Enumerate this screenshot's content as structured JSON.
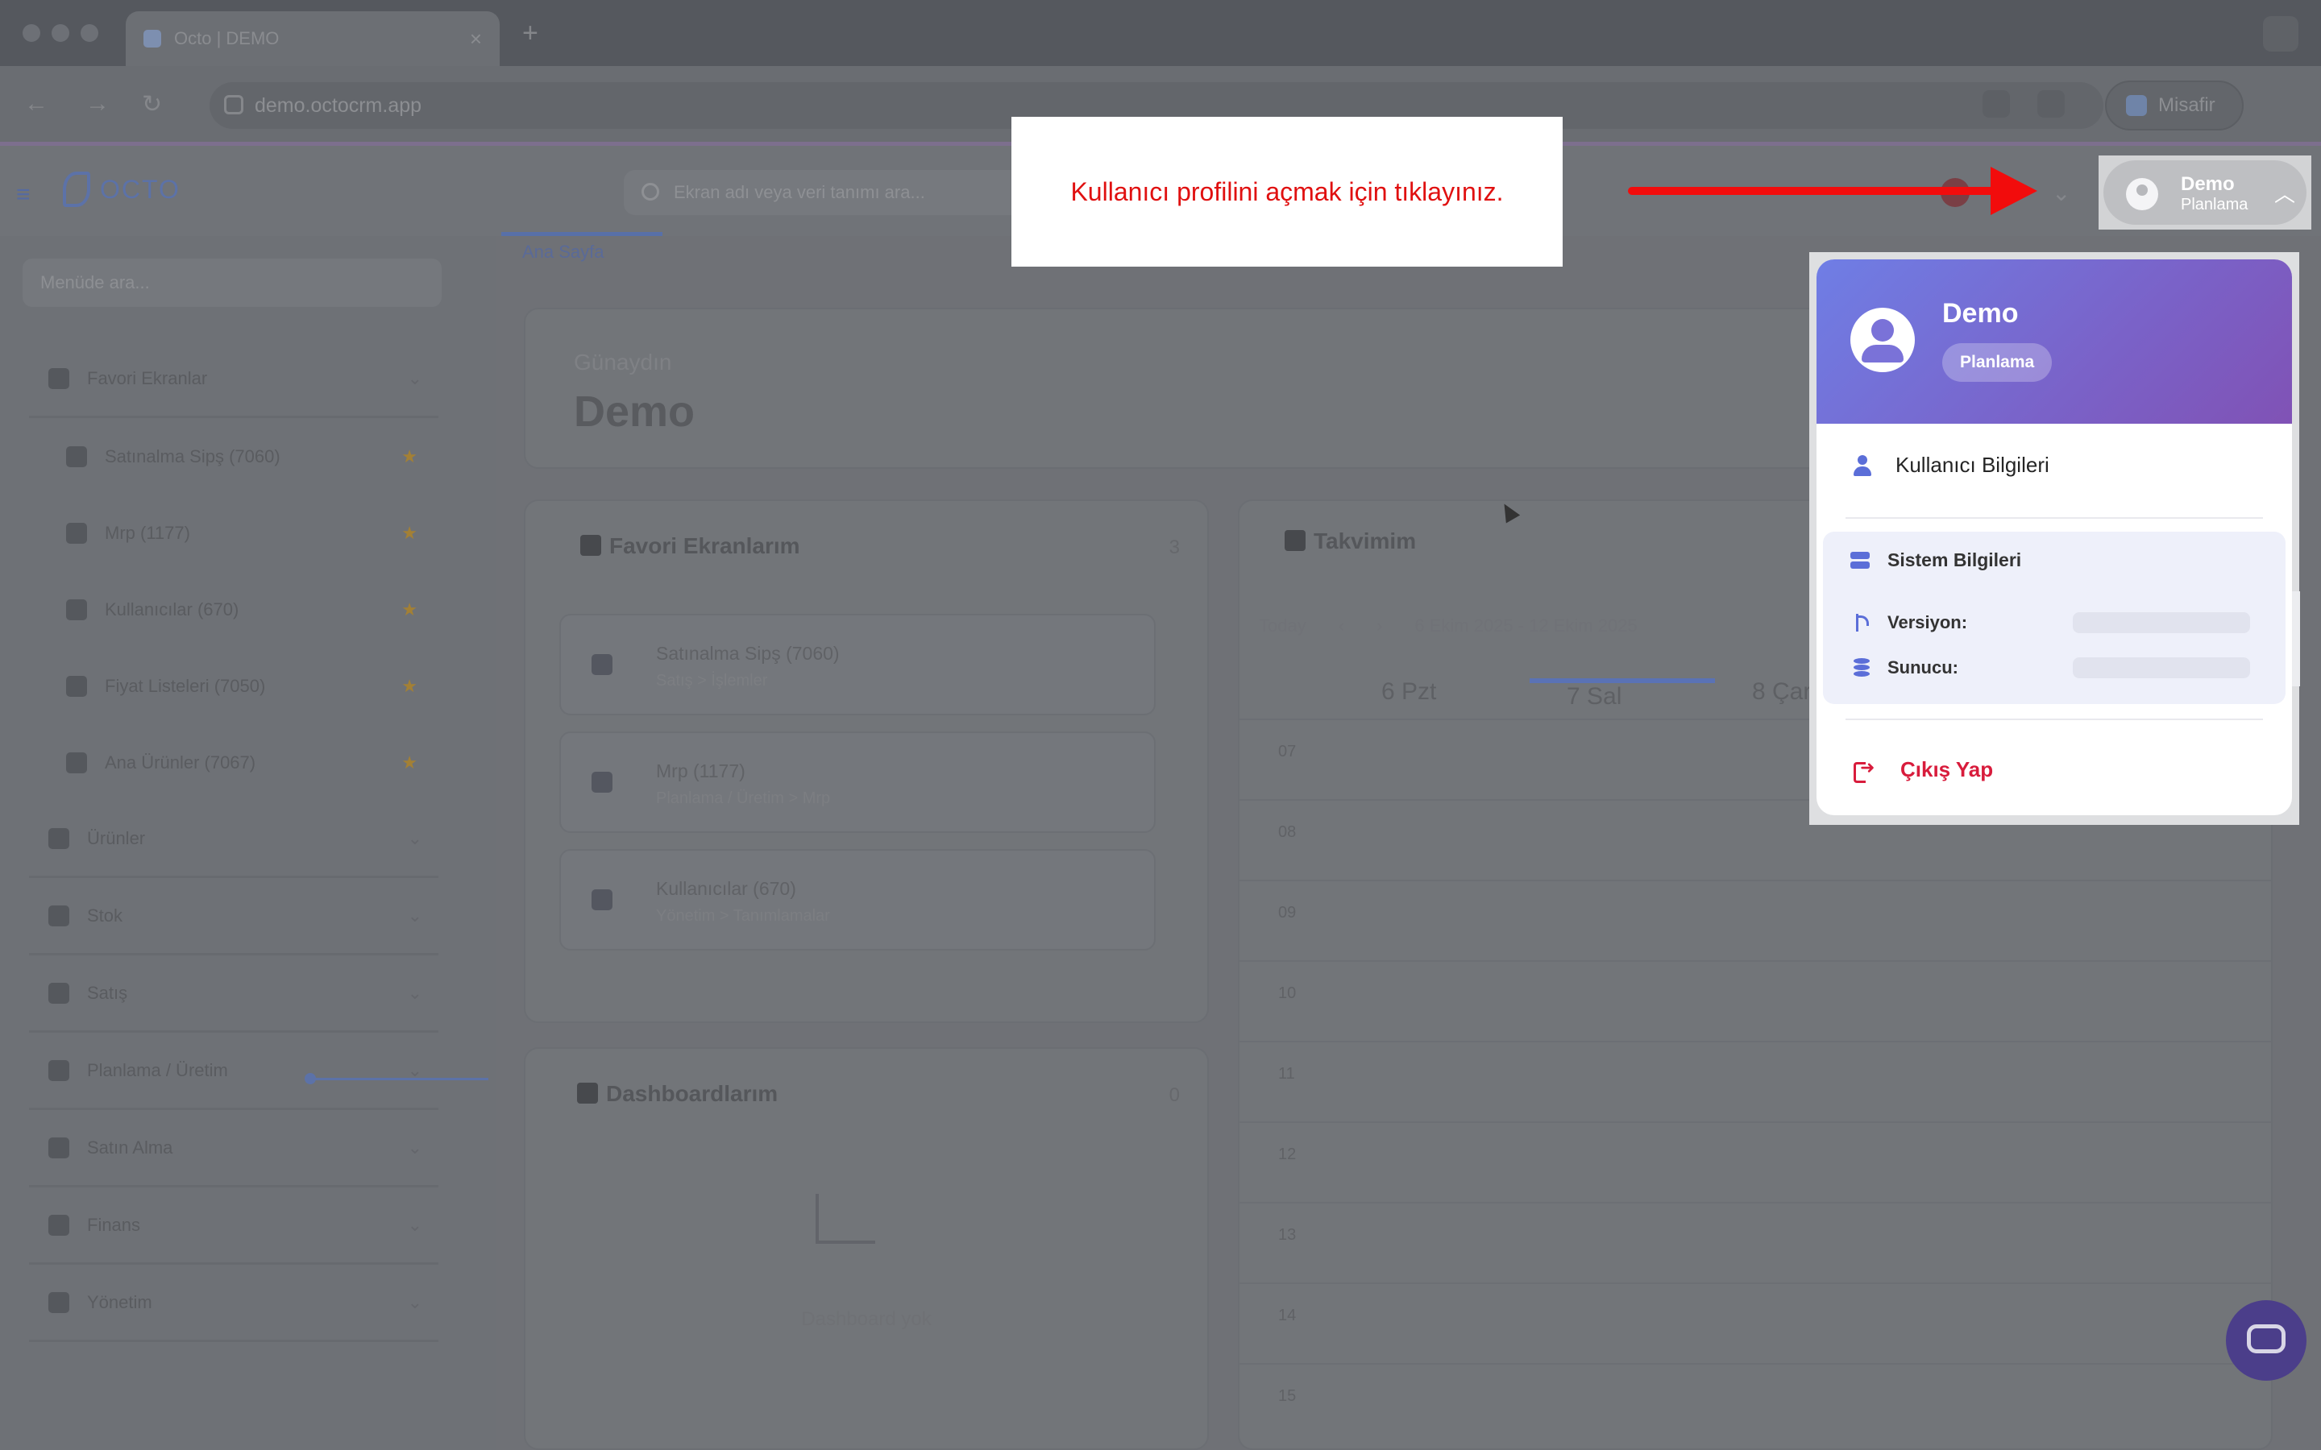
{
  "browser": {
    "tab_title": "Octo | DEMO",
    "new_tab": "+",
    "url": "demo.octocrm.app",
    "profile_label": "Misafir"
  },
  "header": {
    "logo_text": "OCTO",
    "search_placeholder": "Ekran adı veya veri tanımı ara...",
    "user_name": "Demo",
    "user_role": "Planlama"
  },
  "sidebar": {
    "search_placeholder": "Menüde ara...",
    "items": [
      {
        "label": "Favori Ekranlar",
        "star": false,
        "sub": false
      },
      {
        "label": "Satınalma Sipş (7060)",
        "star": true,
        "sub": true
      },
      {
        "label": "Mrp (1177)",
        "star": true,
        "sub": true
      },
      {
        "label": "Kullanıcılar (670)",
        "star": true,
        "sub": true
      },
      {
        "label": "Fiyat Listeleri (7050)",
        "star": true,
        "sub": true
      },
      {
        "label": "Ana Ürünler (7067)",
        "star": true,
        "sub": true
      },
      {
        "label": "Ürünler",
        "star": false,
        "sub": false
      },
      {
        "label": "Stok",
        "star": false,
        "sub": false
      },
      {
        "label": "Satış",
        "star": false,
        "sub": false
      },
      {
        "label": "Planlama / Üretim",
        "star": false,
        "sub": false
      },
      {
        "label": "Satın Alma",
        "star": false,
        "sub": false
      },
      {
        "label": "Finans",
        "star": false,
        "sub": false
      },
      {
        "label": "Yönetim",
        "star": false,
        "sub": false
      }
    ]
  },
  "main": {
    "breadcrumb": "Ana Sayfa",
    "greeting": "Günaydın",
    "greeting_name": "Demo",
    "favorites_title": "Favori Ekranlarım",
    "favorites_count": "3",
    "favorites": [
      {
        "title": "Satınalma Sipş (7060)",
        "path": "Satış > İşlemler"
      },
      {
        "title": "Mrp (1177)",
        "path": "Planlama / Üretim > Mrp"
      },
      {
        "title": "Kullanıcılar (670)",
        "path": "Yönetim > Tanımlamalar"
      }
    ],
    "dashboards_title": "Dashboardlarım",
    "dashboards_count": "0",
    "dashboards_empty": "Dashboard yok",
    "calendar_title": "Takvimim",
    "calendar_today": "Today",
    "calendar_range": "6 Ekim 2025 - 12 Ekim 2025",
    "calendar_days": [
      "6 Pzt",
      "7 Sal",
      "8 Çar"
    ],
    "calendar_hours": [
      "07",
      "08",
      "09",
      "10",
      "11",
      "12",
      "13",
      "14",
      "15"
    ]
  },
  "tutorial": {
    "message": "Kullanıcı profilini açmak için tıklayınız.",
    "arrow_color": "#f20c0c"
  },
  "profile_menu": {
    "name": "Demo",
    "role": "Planlama",
    "user_info": "Kullanıcı Bilgileri",
    "system_info_title": "Sistem Bilgileri",
    "version_label": "Versiyon:",
    "server_label": "Sunucu:",
    "logout": "Çıkış Yap"
  },
  "colors": {
    "accent": "#5b6ed8",
    "gradient_start": "#6f7ee5",
    "gradient_end": "#8052b5",
    "logout": "#d81c3c"
  }
}
